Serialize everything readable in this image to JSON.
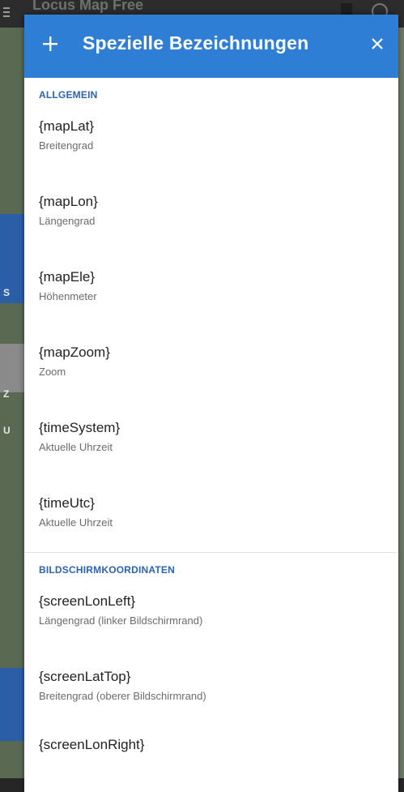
{
  "background": {
    "app_title": "Locus Map Free",
    "side_labels": [
      "S",
      "Z",
      "U"
    ]
  },
  "dialog": {
    "title": "Spezielle Bezeichnungen",
    "add_icon": "plus-icon",
    "close_icon": "close-icon",
    "accent_color": "#2e7ed6",
    "sections": [
      {
        "header": "ALLGEMEIN",
        "items": [
          {
            "name": "{mapLat}",
            "desc": "Breitengrad"
          },
          {
            "name": "{mapLon}",
            "desc": "Längengrad"
          },
          {
            "name": "{mapEle}",
            "desc": "Höhenmeter"
          },
          {
            "name": "{mapZoom}",
            "desc": "Zoom"
          },
          {
            "name": "{timeSystem}",
            "desc": "Aktuelle Uhrzeit"
          },
          {
            "name": "{timeUtc}",
            "desc": "Aktuelle Uhrzeit"
          }
        ]
      },
      {
        "header": "BILDSCHIRMKOORDINATEN",
        "items": [
          {
            "name": "{screenLonLeft}",
            "desc": "Längengrad (linker Bildschirmrand)"
          },
          {
            "name": "{screenLatTop}",
            "desc": "Breitengrad (oberer Bildschirmrand)"
          },
          {
            "name": "{screenLonRight}",
            "desc": ""
          }
        ]
      }
    ]
  }
}
